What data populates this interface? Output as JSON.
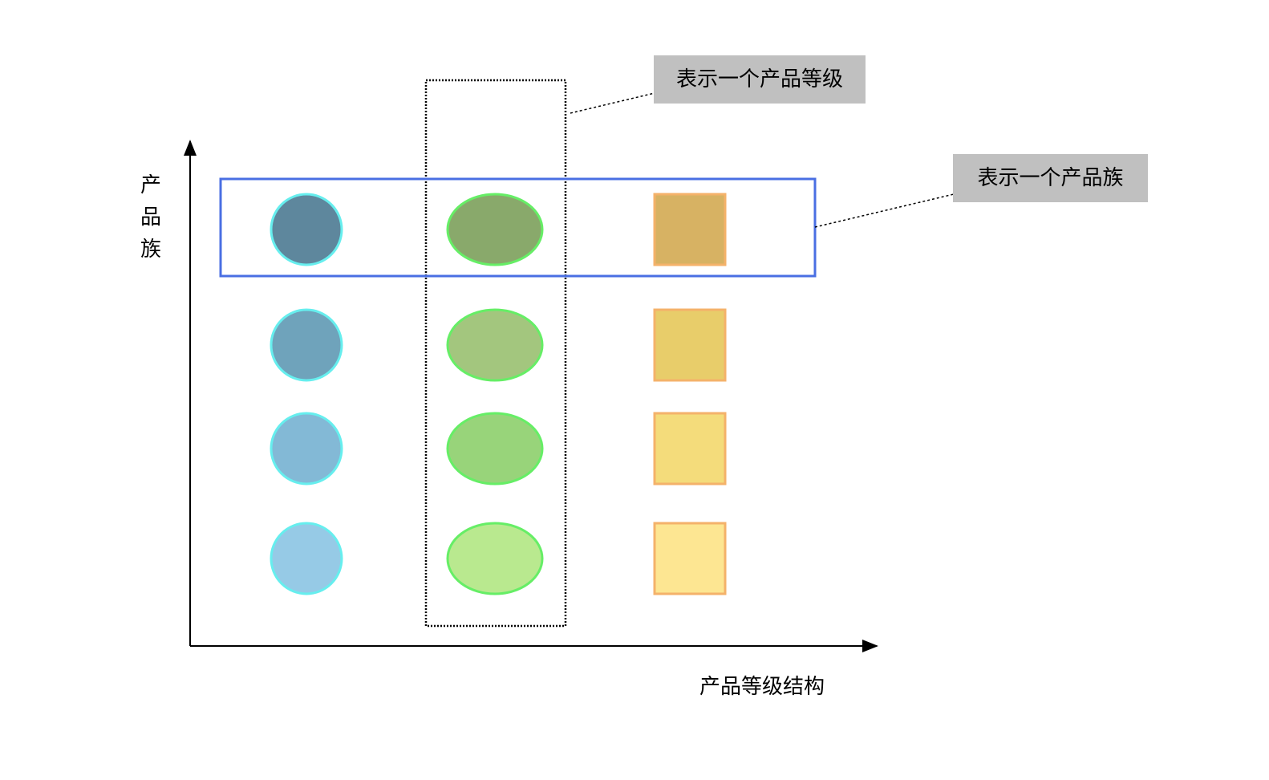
{
  "labels": {
    "y_axis_chars": [
      "产",
      "品",
      "族"
    ],
    "x_axis": "产品等级结构",
    "callout_grade": "表示一个产品等级",
    "callout_family": "表示一个产品族"
  },
  "columns": [
    {
      "shape": "circle",
      "stroke": "#66eeee",
      "fills": [
        "#5e879d",
        "#6fa3bb",
        "#83b9d6",
        "#96cae6"
      ]
    },
    {
      "shape": "ellipse",
      "stroke": "#66ee66",
      "fills": [
        "#89a96b",
        "#a3c67e",
        "#98d47a",
        "#b9e98f"
      ]
    },
    {
      "shape": "square",
      "stroke": "#f4b26a",
      "fills": [
        "#d7b263",
        "#e8cd6a",
        "#f4dc7b",
        "#fde692"
      ]
    }
  ],
  "colors": {
    "axis": "#000000",
    "family_box": "#4a6fe3",
    "grade_box": "#000000",
    "callout_bg": "#c0c0c0"
  }
}
